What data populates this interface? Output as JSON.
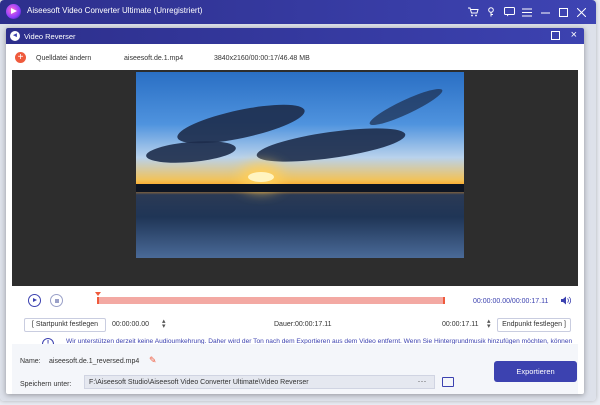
{
  "app": {
    "title": "Aiseesoft Video Converter Ultimate (Unregistriert)"
  },
  "titlebar": {
    "icons": [
      "cart-icon",
      "key-icon",
      "feedback-icon",
      "menu-icon",
      "minimize-icon",
      "maximize-icon",
      "close-icon"
    ]
  },
  "dialog": {
    "title": "Video Reverser",
    "source_label": "Quelldatei ändern",
    "file_name": "aiseesoft.de.1.mp4",
    "file_meta": "3840x2160/00:00:17/46.48 MB"
  },
  "player": {
    "timecode": "00:00:00.00/00:00:17.11"
  },
  "range": {
    "start_button": "Startpunkt festlegen",
    "start_time": "00:00:00.00",
    "duration": "Dauer:00:00:17.11",
    "end_time": "00:00:17.11",
    "end_button": "Endpunkt festlegen"
  },
  "info": {
    "text": "Wir unterstützen derzeit keine Audioumkehrung. Daher wird der Ton nach dem Exportieren aus dem Video entfernt. Wenn Sie Hintergrundmusik hinzufügen möchten, können Sie im Tab \"Converter\" eine Audiospur hinzufügen."
  },
  "output": {
    "name_label": "Name:",
    "name_value": "aiseesoft.de.1_reversed.mp4",
    "save_label": "Speichern unter:",
    "save_path": "F:\\Aiseesoft Studio\\Aiseesoft Video Converter Ultimate\\Video Reverser",
    "export_button": "Exportieren"
  },
  "colors": {
    "accent": "#3c42b0",
    "titlebar": "#2d2f8c",
    "trim": "#ef5a3c",
    "trim_fill": "#f3a9a3"
  }
}
